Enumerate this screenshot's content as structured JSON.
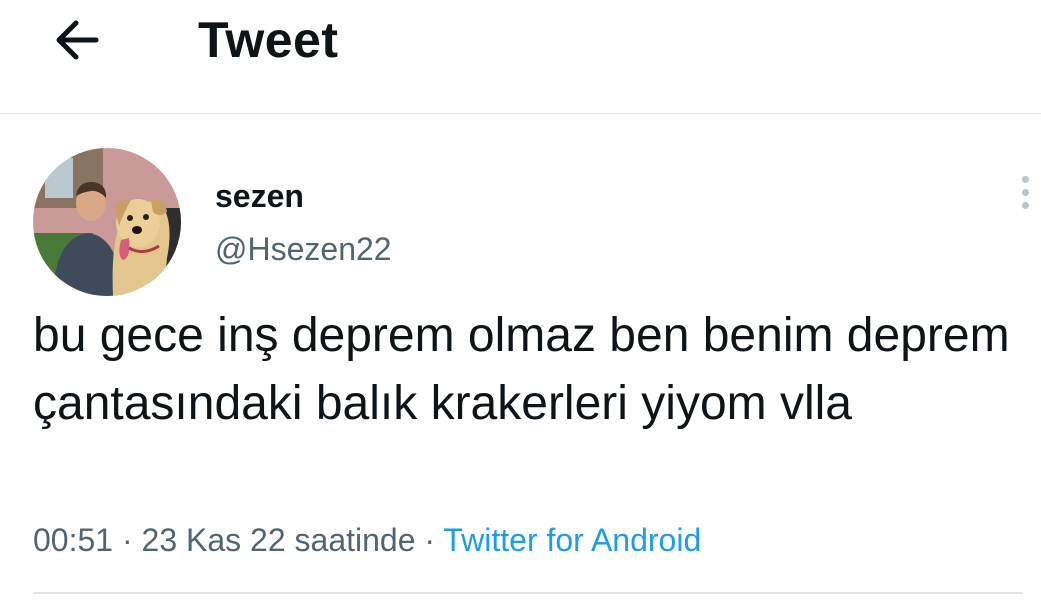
{
  "header": {
    "back_icon": "arrow-left-icon",
    "title": "Tweet"
  },
  "author": {
    "display_name": "sezen",
    "handle": "@Hsezen22",
    "avatar": "avatar-photo-man-with-golden-retriever"
  },
  "tweet": {
    "text": "bu gece inş deprem olmaz ben benim deprem çantasındaki balık krakerleri yiyom vlla",
    "time": "00:51",
    "date_suffix": "23 Kas 22 saatinde",
    "separator": "·",
    "source": "Twitter for Android",
    "more_icon": "more-vertical-icon"
  },
  "colors": {
    "text_primary": "#0f1419",
    "text_secondary": "#536471",
    "link": "#1d9bf0",
    "divider": "#e1e5e9"
  }
}
